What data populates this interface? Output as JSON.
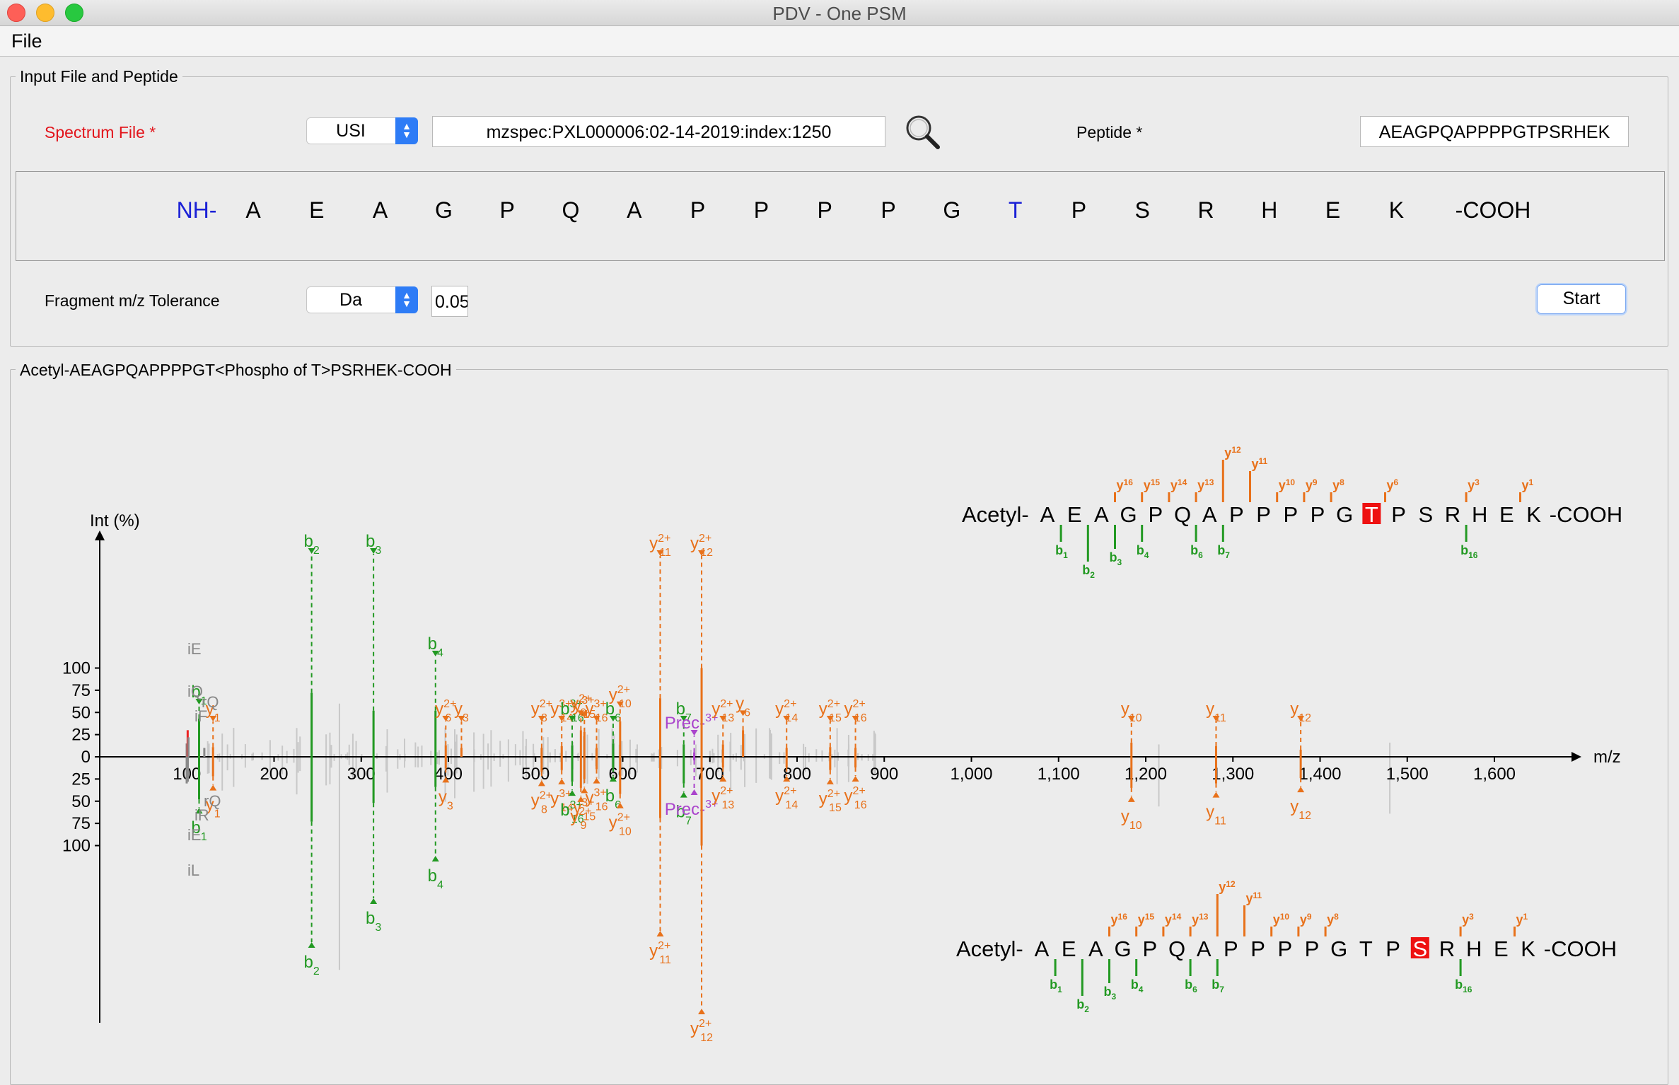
{
  "window": {
    "title": "PDV - One PSM"
  },
  "menu": {
    "file": "File"
  },
  "input_group": {
    "legend": "Input File and Peptide",
    "spectrum_label": "Spectrum File *",
    "source_select": "USI",
    "usi_value": "mzspec:PXL000006:02-14-2019:index:1250",
    "peptide_label": "Peptide *",
    "peptide_value": "AEAGPQAPPPPGTPSRHEK",
    "sequence": [
      "NH-",
      "A",
      "E",
      "A",
      "G",
      "P",
      "Q",
      "A",
      "P",
      "P",
      "P",
      "P",
      "G",
      "T",
      "P",
      "S",
      "R",
      "H",
      "E",
      "K",
      "-COOH"
    ],
    "tolerance_label": "Fragment m/z Tolerance",
    "tolerance_unit": "Da",
    "tolerance_value": "0.05",
    "start_button": "Start"
  },
  "spectrum_group": {
    "legend": "Acetyl-AEAGPQAPPPPGT<Phospho of T>PSRHEK-COOH"
  },
  "chart_data": {
    "type": "mirror-spectrum",
    "xlabel": "m/z",
    "ylabel": "Int (%)",
    "xticks": [
      100,
      200,
      300,
      400,
      500,
      600,
      700,
      800,
      900,
      1000,
      1100,
      1200,
      1300,
      1400,
      1500,
      1600
    ],
    "xtick_labels": [
      "100",
      "200",
      "300",
      "400",
      "500",
      "600",
      "700",
      "800",
      "900",
      "1,000",
      "1,100",
      "1,200",
      "1,300",
      "1,400",
      "1,500",
      "1,600"
    ],
    "yticks": [
      0,
      25,
      50,
      75,
      100
    ],
    "xlim": [
      0,
      1700
    ],
    "ylim": [
      -100,
      100
    ],
    "colors": {
      "b": "#229922",
      "y": "#e8711a",
      "noise": "#c8c8c8",
      "other": "#888888",
      "precursor": "#aa44cc",
      "mod": "#ee2222"
    },
    "top_peaks": [
      {
        "mz": 99.8,
        "i": 15,
        "ion": "other"
      },
      {
        "mz": 100.9,
        "i": 30,
        "ion": "mod"
      },
      {
        "mz": 101.8,
        "i": 22,
        "ion": "other"
      },
      {
        "mz": 114.0,
        "i": 43,
        "ion": "b",
        "label": "b",
        "sub": "1"
      },
      {
        "mz": 120.0,
        "i": 10,
        "ion": "other"
      },
      {
        "mz": 130.0,
        "i": 11,
        "ion": "y",
        "label": "y",
        "sub": "1"
      },
      {
        "mz": 243.1,
        "i": 72,
        "ion": "b",
        "label": "b",
        "sub": "2"
      },
      {
        "mz": 314.1,
        "i": 52,
        "ion": "b",
        "label": "b",
        "sub": "3"
      },
      {
        "mz": 385.2,
        "i": 52,
        "ion": "b",
        "label": "b",
        "sub": "4"
      },
      {
        "mz": 397.0,
        "i": 13,
        "ion": "y",
        "label": "y",
        "sup": "2+",
        "sub": "6"
      },
      {
        "mz": 415.0,
        "i": 10,
        "ion": "y",
        "label": "y",
        "sub": "3"
      },
      {
        "mz": 507.0,
        "i": 10,
        "ion": "y",
        "label": "y",
        "sup": "2+",
        "sub": "8"
      },
      {
        "mz": 530.0,
        "i": 12,
        "ion": "y",
        "label": "y",
        "sup": "3+",
        "sub": "14"
      },
      {
        "mz": 542.0,
        "i": 13,
        "ion": "b",
        "label": "b",
        "sup": "3+",
        "sub": "16"
      },
      {
        "mz": 552.0,
        "i": 30,
        "ion": "y",
        "label": "y",
        "sup": "2+",
        "sub": "9"
      },
      {
        "mz": 556.0,
        "i": 28,
        "ion": "y",
        "label": "y",
        "sup": "3+",
        "sub": "15"
      },
      {
        "mz": 570.0,
        "i": 10,
        "ion": "y",
        "label": "y",
        "sup": "3+",
        "sub": "16"
      },
      {
        "mz": 589.0,
        "i": 15,
        "ion": "b",
        "label": "b",
        "sub": "6"
      },
      {
        "mz": 597.0,
        "i": 40,
        "ion": "y",
        "label": "y",
        "sup": "2+",
        "sub": "10"
      },
      {
        "mz": 643.0,
        "i": 66,
        "ion": "y",
        "label": "y",
        "sup": "2+",
        "sub": "11"
      },
      {
        "mz": 670.0,
        "i": 14,
        "ion": "b",
        "label": "b",
        "sub": "7"
      },
      {
        "mz": 682.0,
        "i": 5,
        "ion": "precursor",
        "label": "Prec-",
        "sup": "3+"
      },
      {
        "mz": 690.5,
        "i": 100,
        "ion": "y",
        "label": "y",
        "sup": "2+",
        "sub": "12"
      },
      {
        "mz": 715.0,
        "i": 14,
        "ion": "y",
        "label": "y",
        "sup": "2+",
        "sub": "13"
      },
      {
        "mz": 738.0,
        "i": 30,
        "ion": "y",
        "label": "y",
        "sub": "6"
      },
      {
        "mz": 788.0,
        "i": 10,
        "ion": "y",
        "label": "y",
        "sup": "2+",
        "sub": "14"
      },
      {
        "mz": 838.0,
        "i": 11,
        "ion": "y",
        "label": "y",
        "sup": "2+",
        "sub": "15"
      },
      {
        "mz": 867.0,
        "i": 10,
        "ion": "y",
        "label": "y",
        "sup": "2+",
        "sub": "16"
      },
      {
        "mz": 1183.6,
        "i": 16,
        "ion": "y",
        "label": "y",
        "sub": "10"
      },
      {
        "mz": 1280.7,
        "i": 12,
        "ion": "y",
        "label": "y",
        "sub": "11"
      },
      {
        "mz": 1377.8,
        "i": 8,
        "ion": "y",
        "label": "y",
        "sub": "12"
      }
    ],
    "bottom_peaks": [
      {
        "mz": 99.8,
        "i": 30,
        "ion": "other"
      },
      {
        "mz": 101.0,
        "i": 28,
        "ion": "other"
      },
      {
        "mz": 114.0,
        "i": 48,
        "ion": "b",
        "label": "b",
        "sub": "1"
      },
      {
        "mz": 130.0,
        "i": 22,
        "ion": "y",
        "label": "y",
        "sub": "1"
      },
      {
        "mz": 243.1,
        "i": 73,
        "ion": "b",
        "label": "b",
        "sub": "2"
      },
      {
        "mz": 314.1,
        "i": 52,
        "ion": "b",
        "label": "b",
        "sub": "3"
      },
      {
        "mz": 385.2,
        "i": 34,
        "ion": "b",
        "label": "b",
        "sub": "4"
      },
      {
        "mz": 397.0,
        "i": 13,
        "ion": "y",
        "label": "y",
        "sub": "3"
      },
      {
        "mz": 507.0,
        "i": 17,
        "ion": "y",
        "label": "y",
        "sup": "2+",
        "sub": "8"
      },
      {
        "mz": 530.0,
        "i": 15,
        "ion": "y",
        "label": "y",
        "sup": "3+",
        "sub": "14"
      },
      {
        "mz": 542.0,
        "i": 28,
        "ion": "b",
        "label": "b",
        "sup": "3+",
        "sub": "16"
      },
      {
        "mz": 552.0,
        "i": 35,
        "ion": "y",
        "label": "y",
        "sup": "2+",
        "sub": "9"
      },
      {
        "mz": 556.0,
        "i": 25,
        "ion": "y",
        "label": "y",
        "sup": "3+",
        "sub": "15"
      },
      {
        "mz": 570.0,
        "i": 14,
        "ion": "y",
        "label": "y",
        "sup": "3+",
        "sub": "16"
      },
      {
        "mz": 589.0,
        "i": 12,
        "ion": "b",
        "label": "b",
        "sub": "6"
      },
      {
        "mz": 597.0,
        "i": 42,
        "ion": "y",
        "label": "y",
        "sup": "2+",
        "sub": "10"
      },
      {
        "mz": 643.0,
        "i": 69,
        "ion": "y",
        "label": "y",
        "sup": "2+",
        "sub": "11"
      },
      {
        "mz": 670.0,
        "i": 30,
        "ion": "b",
        "label": "b",
        "sub": "7"
      },
      {
        "mz": 682.0,
        "i": 4,
        "ion": "precursor",
        "label": "Prec-",
        "sup": "3+"
      },
      {
        "mz": 690.5,
        "i": 100,
        "ion": "y",
        "label": "y",
        "sup": "2+",
        "sub": "12"
      },
      {
        "mz": 715.0,
        "i": 12,
        "ion": "y",
        "label": "y",
        "sup": "2+",
        "sub": "13"
      },
      {
        "mz": 788.0,
        "i": 12,
        "ion": "y",
        "label": "y",
        "sup": "2+",
        "sub": "14"
      },
      {
        "mz": 838.0,
        "i": 15,
        "ion": "y",
        "label": "y",
        "sup": "2+",
        "sub": "15"
      },
      {
        "mz": 867.0,
        "i": 12,
        "ion": "y",
        "label": "y",
        "sup": "2+",
        "sub": "16"
      },
      {
        "mz": 1183.6,
        "i": 35,
        "ion": "y",
        "label": "y",
        "sub": "10"
      },
      {
        "mz": 1280.7,
        "i": 30,
        "ion": "y",
        "label": "y",
        "sub": "11"
      },
      {
        "mz": 1377.8,
        "i": 24,
        "ion": "y",
        "label": "y",
        "sub": "12"
      }
    ],
    "immonium_labels": [
      "iE",
      "iQ",
      "rQ",
      "iF",
      "iR",
      "iL"
    ],
    "annotated_sequences": {
      "top": {
        "prefix": "Acetyl-",
        "residues": [
          "A",
          "E",
          "A",
          "G",
          "P",
          "Q",
          "A",
          "P",
          "P",
          "P",
          "P",
          "G",
          "T",
          "P",
          "S",
          "R",
          "H",
          "E",
          "K"
        ],
        "suffix": "-COOH",
        "modified_index": 12,
        "b_ions": [
          1,
          2,
          3,
          4,
          6,
          7,
          16
        ],
        "y_ions": [
          16,
          15,
          14,
          13,
          12,
          11,
          10,
          9,
          8,
          6,
          3,
          1
        ]
      },
      "bottom": {
        "prefix": "Acetyl-",
        "residues": [
          "A",
          "E",
          "A",
          "G",
          "P",
          "Q",
          "A",
          "P",
          "P",
          "P",
          "P",
          "G",
          "T",
          "P",
          "S",
          "R",
          "H",
          "E",
          "K"
        ],
        "suffix": "-COOH",
        "modified_index": 14,
        "b_ions": [
          1,
          2,
          3,
          4,
          6,
          7,
          16
        ],
        "y_ions": [
          16,
          15,
          14,
          13,
          12,
          11,
          10,
          9,
          8,
          3,
          1
        ]
      }
    }
  }
}
